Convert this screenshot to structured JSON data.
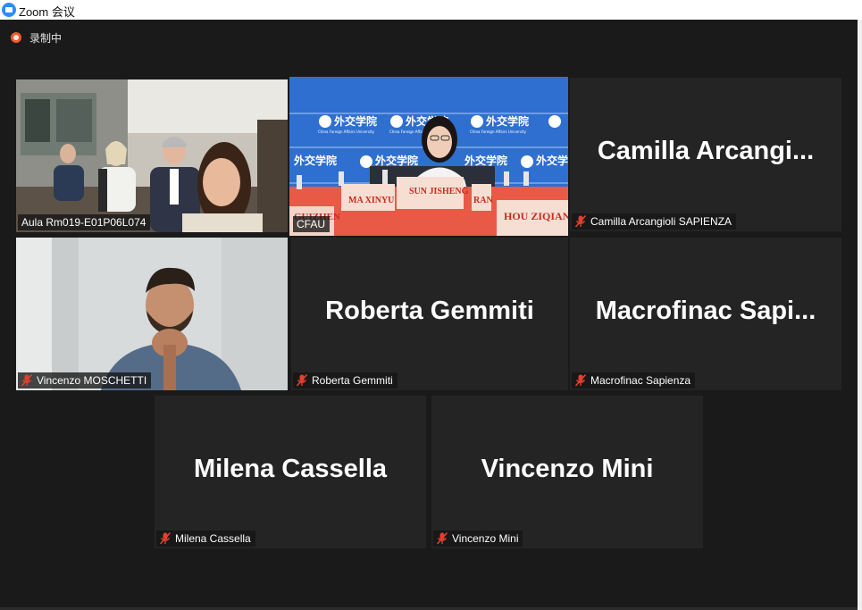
{
  "window": {
    "title": "Zoom 会议",
    "icon": "zoom-logo-icon"
  },
  "recording": {
    "label": "录制中",
    "icon": "recording-icon",
    "color": "#f05a2a"
  },
  "active_speaker_color": "#c9e266",
  "participants": [
    {
      "name": "Aula Rm019-E01P06L074",
      "video": true,
      "muted": false
    },
    {
      "name": "CFAU",
      "video": true,
      "muted": false,
      "active": true,
      "scene_text": {
        "banner": "外交学院",
        "banner_sub": "China Foreign Affairs University",
        "plates": [
          "SUN JISHENG",
          "MA XINYU",
          "HOU ZIQIAN",
          "RAN",
          "GUIZHEN"
        ]
      }
    },
    {
      "name": "Camilla Arcangioli SAPIENZA",
      "display_name": "Camilla  Arcangi...",
      "video": false,
      "muted": true
    },
    {
      "name": "Vincenzo MOSCHETTI",
      "video": true,
      "muted": true
    },
    {
      "name": "Roberta Gemmiti",
      "display_name": "Roberta Gemmiti",
      "video": false,
      "muted": true
    },
    {
      "name": "Macrofinac Sapienza",
      "display_name": "Macrofinac  Sapi...",
      "video": false,
      "muted": true
    },
    {
      "name": "Milena Cassella",
      "display_name": "Milena Cassella",
      "video": false,
      "muted": true
    },
    {
      "name": "Vincenzo Mini",
      "display_name": "Vincenzo Mini",
      "video": false,
      "muted": true
    }
  ]
}
